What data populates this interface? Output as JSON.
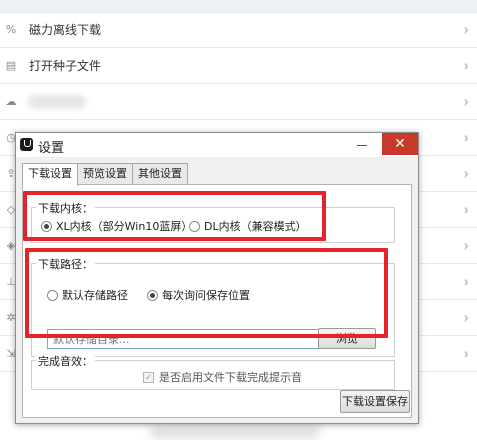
{
  "list": {
    "items": [
      {
        "icon": "link-icon",
        "glyph": "%",
        "label": "磁力离线下载"
      },
      {
        "icon": "file-icon",
        "glyph": "▤",
        "label": "打开种子文件"
      },
      {
        "icon": "cloud-icon",
        "glyph": "☁",
        "label": ""
      },
      {
        "icon": "clock-icon",
        "glyph": "◷",
        "label": ""
      },
      {
        "icon": "upload-icon",
        "glyph": "⇪",
        "label": ""
      },
      {
        "icon": "diamond-icon",
        "glyph": "◇",
        "label": ""
      },
      {
        "icon": "shield-icon",
        "glyph": "◈",
        "label": ""
      },
      {
        "icon": "network-icon",
        "glyph": "⊥",
        "label": ""
      },
      {
        "icon": "gear-icon",
        "glyph": "✲",
        "label": ""
      },
      {
        "icon": "exit-icon",
        "glyph": "⇲",
        "label": ""
      }
    ],
    "chevron": "›"
  },
  "dialog": {
    "title": "设置",
    "minimize": "",
    "close": "✕",
    "tabs": [
      "下载设置",
      "预览设置",
      "其他设置"
    ],
    "kernel": {
      "label": "下载内核：",
      "options": [
        "XL内核（部分Win10蓝屏）",
        "DL内核（兼容模式）"
      ],
      "selected": 0
    },
    "path": {
      "label": "下载路径：",
      "options": [
        "默认存储路径",
        "每次询问保存位置"
      ],
      "selected": 1,
      "placeholder": "默认存储目录...",
      "browse": "浏览"
    },
    "sound": {
      "label": "完成音效：",
      "checkbox_label": "是否启用文件下载完成提示音",
      "checked": true
    },
    "save": "下载设置保存"
  },
  "colors": {
    "highlight": "#e3242b",
    "close_button": "#c8382b"
  }
}
